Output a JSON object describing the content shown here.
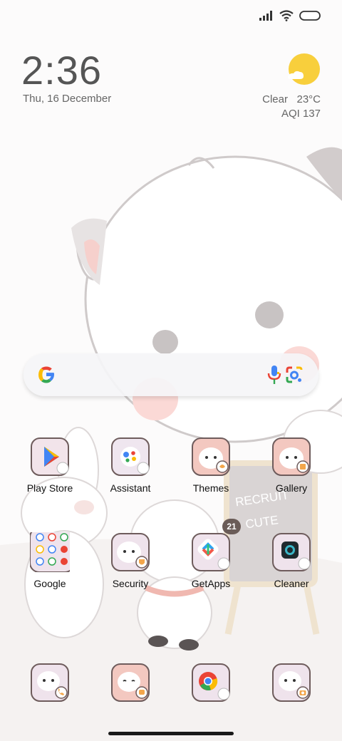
{
  "status": {
    "signal_icon": "signal-icon",
    "wifi_icon": "wifi-icon",
    "battery_icon": "battery-icon"
  },
  "clock": {
    "time": "2:36",
    "date": "Thu, 16 December"
  },
  "weather": {
    "condition": "Clear",
    "temperature": "23°C",
    "aqi": "AQI 137",
    "icon": "sun-cloud-icon"
  },
  "search": {
    "logo": "google-logo",
    "mic_icon": "mic-icon",
    "lens_icon": "lens-icon"
  },
  "apps_row1": [
    {
      "label": "Play Store"
    },
    {
      "label": "Assistant"
    },
    {
      "label": "Themes"
    },
    {
      "label": "Gallery"
    }
  ],
  "apps_row2": [
    {
      "label": "Google"
    },
    {
      "label": "Security"
    },
    {
      "label": "GetApps",
      "badge": "21"
    },
    {
      "label": "Cleaner"
    }
  ],
  "dock": [
    {
      "name": "phone"
    },
    {
      "name": "messages"
    },
    {
      "name": "chrome"
    },
    {
      "name": "camera"
    }
  ],
  "wallpaper": {
    "sign_line1": "RECRUIT",
    "sign_line2": "CUTE"
  },
  "colors": {
    "accent_pink": "#f3c8c0",
    "icon_bg": "#e9dcec",
    "badge": "#6a5c58"
  }
}
